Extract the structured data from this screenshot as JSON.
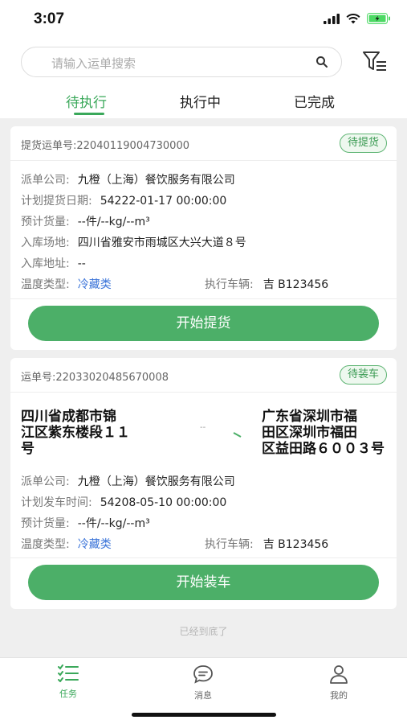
{
  "status": {
    "time": "3:07"
  },
  "search": {
    "placeholder": "请输入运单搜索"
  },
  "tabs": [
    {
      "label": "待执行",
      "active": true
    },
    {
      "label": "执行中",
      "active": false
    },
    {
      "label": "已完成",
      "active": false
    }
  ],
  "card1": {
    "no_label": "提货运单号:",
    "no_value": "22040119004730000",
    "badge": "待提货",
    "rows": [
      {
        "label": "派单公司:",
        "value": "九橙（上海）餐饮服务有限公司"
      },
      {
        "label": "计划提货日期:",
        "value": "54222-01-17 00:00:00"
      },
      {
        "label": "预计货量:",
        "value": "--件/--kg/--m³"
      },
      {
        "label": "入库场地:",
        "value": "四川省雅安市雨城区大兴大道８号"
      },
      {
        "label": "入库地址:",
        "value": "--"
      }
    ],
    "temp_label": "温度类型:",
    "temp_value": "冷藏类",
    "vehicle_label": "执行车辆:",
    "vehicle_value": "吉 B123456",
    "button": "开始提货"
  },
  "card2": {
    "no_label": "运单号:",
    "no_value": "22033020485670008",
    "badge": "待装车",
    "from_lines": [
      "四川省成都市锦",
      "江区紫东楼段１１",
      "号"
    ],
    "to_lines": [
      "广东省深圳市福",
      "田区深圳市福田",
      "区益田路６００３号"
    ],
    "distance": "--",
    "rows": [
      {
        "label": "派单公司:",
        "value": "九橙（上海）餐饮服务有限公司"
      },
      {
        "label": "计划发车时间:",
        "value": "54208-05-10 00:00:00"
      },
      {
        "label": "预计货量:",
        "value": "--件/--kg/--m³"
      }
    ],
    "temp_label": "温度类型:",
    "temp_value": "冷藏类",
    "vehicle_label": "执行车辆:",
    "vehicle_value": "吉 B123456",
    "button": "开始装车"
  },
  "footer_note": "已经到底了",
  "tabbar": [
    {
      "label": "任务",
      "icon": "task-list-icon",
      "active": true
    },
    {
      "label": "消息",
      "icon": "message-icon",
      "active": false
    },
    {
      "label": "我的",
      "icon": "user-icon",
      "active": false
    }
  ],
  "colors": {
    "accent": "#4caf68",
    "link": "#3a73d8",
    "background": "#efefef"
  }
}
